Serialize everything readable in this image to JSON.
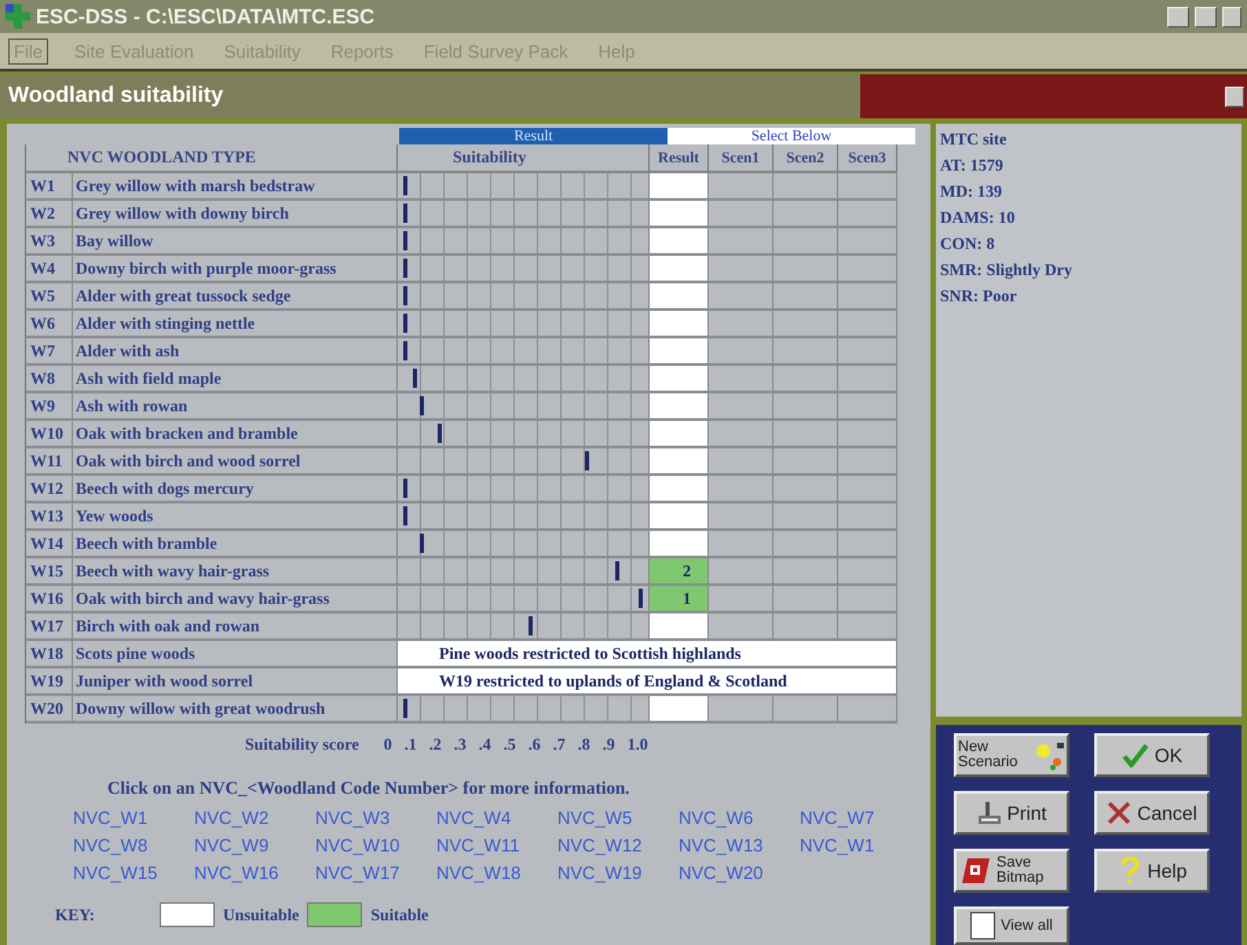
{
  "window": {
    "title": "ESC-DSS - C:\\ESC\\DATA\\MTC.ESC"
  },
  "menu": [
    {
      "label": "File",
      "disabled": true,
      "selected": true
    },
    {
      "label": "Site Evaluation",
      "disabled": true,
      "selected": false
    },
    {
      "label": "Suitability",
      "disabled": true,
      "selected": false
    },
    {
      "label": "Reports",
      "disabled": true,
      "selected": false
    },
    {
      "label": "Field Survey Pack",
      "disabled": true,
      "selected": false
    },
    {
      "label": "Help",
      "disabled": true,
      "selected": false
    }
  ],
  "dialog": {
    "title": "Woodland suitability"
  },
  "table": {
    "banner_result": "Result",
    "banner_select": "Select Below",
    "columns": [
      "NVC WOODLAND TYPE",
      "Suitability",
      "Result",
      "Scen1",
      "Scen2",
      "Scen3"
    ],
    "rows": [
      {
        "code": "W1",
        "name": "Grey willow with marsh bedstraw",
        "kind": "bar",
        "level": 0.02,
        "result": "",
        "suitable": false
      },
      {
        "code": "W2",
        "name": "Grey willow with downy birch",
        "kind": "bar",
        "level": 0.02,
        "result": "",
        "suitable": false
      },
      {
        "code": "W3",
        "name": "Bay willow",
        "kind": "bar",
        "level": 0.02,
        "result": "",
        "suitable": false
      },
      {
        "code": "W4",
        "name": "Downy birch with purple moor-grass",
        "kind": "bar",
        "level": 0.02,
        "result": "",
        "suitable": false
      },
      {
        "code": "W5",
        "name": "Alder with great tussock sedge",
        "kind": "bar",
        "level": 0.02,
        "result": "",
        "suitable": false
      },
      {
        "code": "W6",
        "name": "Alder with stinging nettle",
        "kind": "bar",
        "level": 0.02,
        "result": "",
        "suitable": false
      },
      {
        "code": "W7",
        "name": "Alder with ash",
        "kind": "bar",
        "level": 0.02,
        "result": "",
        "suitable": false
      },
      {
        "code": "W8",
        "name": "Ash with field maple",
        "kind": "bar",
        "level": 0.06,
        "result": "",
        "suitable": false
      },
      {
        "code": "W9",
        "name": "Ash with rowan",
        "kind": "bar",
        "level": 0.09,
        "result": "",
        "suitable": false
      },
      {
        "code": "W10",
        "name": "Oak with bracken and bramble",
        "kind": "bar",
        "level": 0.16,
        "result": "",
        "suitable": false
      },
      {
        "code": "W11",
        "name": "Oak with birch and wood sorrel",
        "kind": "bar",
        "level": 0.76,
        "result": "",
        "suitable": false
      },
      {
        "code": "W12",
        "name": "Beech with dogs mercury",
        "kind": "bar",
        "level": 0.02,
        "result": "",
        "suitable": false
      },
      {
        "code": "W13",
        "name": "Yew woods",
        "kind": "bar",
        "level": 0.02,
        "result": "",
        "suitable": false
      },
      {
        "code": "W14",
        "name": "Beech with bramble",
        "kind": "bar",
        "level": 0.09,
        "result": "",
        "suitable": false
      },
      {
        "code": "W15",
        "name": "Beech with wavy hair-grass",
        "kind": "bar",
        "level": 0.88,
        "result": "2",
        "suitable": true
      },
      {
        "code": "W16",
        "name": "Oak with birch and wavy hair-grass",
        "kind": "bar",
        "level": 0.98,
        "result": "1",
        "suitable": true
      },
      {
        "code": "W17",
        "name": "Birch with oak and rowan",
        "kind": "bar",
        "level": 0.53,
        "result": "",
        "suitable": false
      },
      {
        "code": "W18",
        "name": "Scots pine woods",
        "kind": "note",
        "note": "Pine woods restricted to Scottish highlands"
      },
      {
        "code": "W19",
        "name": "Juniper with wood sorrel",
        "kind": "note",
        "note": "W19 restricted to uplands of England & Scotland"
      },
      {
        "code": "W20",
        "name": "Downy willow with great woodrush",
        "kind": "bar",
        "level": 0.02,
        "result": "",
        "suitable": false
      }
    ]
  },
  "scale": {
    "label": "Suitability score",
    "ticks": [
      "0",
      ".1",
      ".2",
      ".3",
      ".4",
      ".5",
      ".6",
      ".7",
      ".8",
      ".9",
      "1.0"
    ]
  },
  "instruction": "Click on an NVC_<Woodland Code Number> for more information.",
  "links": [
    "NVC_W1",
    "NVC_W2",
    "NVC_W3",
    "NVC_W4",
    "NVC_W5",
    "NVC_W6",
    "NVC_W7",
    "NVC_W8",
    "NVC_W9",
    "NVC_W10",
    "NVC_W11",
    "NVC_W12",
    "NVC_W13",
    "NVC_W1",
    "NVC_W15",
    "NVC_W16",
    "NVC_W17",
    "NVC_W18",
    "NVC_W19",
    "NVC_W20"
  ],
  "key": {
    "label": "KEY:",
    "items": [
      {
        "label": "Unsuitable",
        "color": "#ffffff"
      },
      {
        "label": "Suitable",
        "color": "#80c870"
      }
    ]
  },
  "site_info": [
    "MTC site",
    "AT: 1579",
    "MD: 139",
    "DAMS: 10",
    "CON: 8",
    "SMR: Slightly Dry",
    "SNR: Poor"
  ],
  "buttons": [
    {
      "label": "New Scenario",
      "kind": "scenario"
    },
    {
      "label": "OK",
      "kind": "ok"
    },
    {
      "label": "Print",
      "kind": "print"
    },
    {
      "label": "Cancel",
      "kind": "cancel"
    },
    {
      "label": "Save Bitmap",
      "kind": "save"
    },
    {
      "label": "Help",
      "kind": "help"
    }
  ],
  "view_all": {
    "label": "View all",
    "checked": false
  }
}
